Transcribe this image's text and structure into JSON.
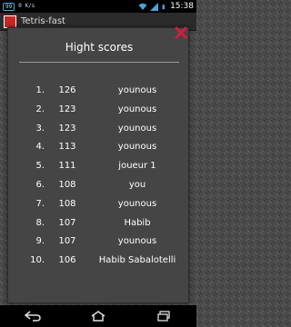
{
  "status_bar": {
    "left_badge": "99",
    "left_kb": "0 K/s\n0 K/s",
    "time": "15:38"
  },
  "app": {
    "title": "Tetris-fast"
  },
  "dialog": {
    "title": "Hight scores",
    "close_icon": "close-icon"
  },
  "scores": [
    {
      "rank": "1.",
      "score": "126",
      "name": "younous"
    },
    {
      "rank": "2.",
      "score": "123",
      "name": "younous"
    },
    {
      "rank": "3.",
      "score": "123",
      "name": "younous"
    },
    {
      "rank": "4.",
      "score": "113",
      "name": "younous"
    },
    {
      "rank": "5.",
      "score": "111",
      "name": "joueur 1"
    },
    {
      "rank": "6.",
      "score": "108",
      "name": "you"
    },
    {
      "rank": "7.",
      "score": "108",
      "name": "younous"
    },
    {
      "rank": "8.",
      "score": "107",
      "name": "Habib"
    },
    {
      "rank": "9.",
      "score": "107",
      "name": "younous"
    },
    {
      "rank": "10.",
      "score": "106",
      "name": "Habib Sabalotelli"
    }
  ],
  "nav": {
    "back_icon": "back-icon",
    "home_icon": "home-icon",
    "recents_icon": "recents-icon"
  },
  "colors": {
    "accent_close": "#d81b3c"
  }
}
